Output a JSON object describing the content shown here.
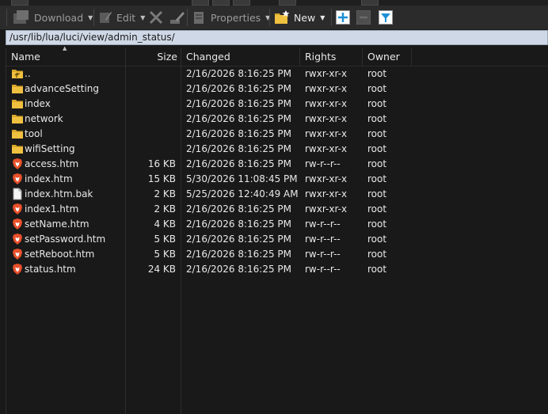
{
  "toolbar": {
    "download_label": "Download",
    "edit_label": "Edit",
    "properties_label": "Properties",
    "new_label": "New"
  },
  "address": {
    "path": "/usr/lib/lua/luci/view/admin_status/"
  },
  "columns": {
    "name": "Name",
    "size": "Size",
    "changed": "Changed",
    "rights": "Rights",
    "owner": "Owner"
  },
  "files": [
    {
      "name": "..",
      "size": "",
      "changed": "2/16/2026 8:16:25 PM",
      "rights": "rwxr-xr-x",
      "owner": "root",
      "icon": "parent-folder-icon"
    },
    {
      "name": "advanceSetting",
      "size": "",
      "changed": "2/16/2026 8:16:25 PM",
      "rights": "rwxr-xr-x",
      "owner": "root",
      "icon": "folder-icon"
    },
    {
      "name": "index",
      "size": "",
      "changed": "2/16/2026 8:16:25 PM",
      "rights": "rwxr-xr-x",
      "owner": "root",
      "icon": "folder-icon"
    },
    {
      "name": "network",
      "size": "",
      "changed": "2/16/2026 8:16:25 PM",
      "rights": "rwxr-xr-x",
      "owner": "root",
      "icon": "folder-icon"
    },
    {
      "name": "tool",
      "size": "",
      "changed": "2/16/2026 8:16:25 PM",
      "rights": "rwxr-xr-x",
      "owner": "root",
      "icon": "folder-icon"
    },
    {
      "name": "wifiSetting",
      "size": "",
      "changed": "2/16/2026 8:16:25 PM",
      "rights": "rwxr-xr-x",
      "owner": "root",
      "icon": "folder-icon"
    },
    {
      "name": "access.htm",
      "size": "16 KB",
      "changed": "2/16/2026 8:16:25 PM",
      "rights": "rw-r--r--",
      "owner": "root",
      "icon": "brave-browser-icon"
    },
    {
      "name": "index.htm",
      "size": "15 KB",
      "changed": "5/30/2026 11:08:45 PM",
      "rights": "rwxr-xr-x",
      "owner": "root",
      "icon": "brave-browser-icon"
    },
    {
      "name": "index.htm.bak",
      "size": "2 KB",
      "changed": "5/25/2026 12:40:49 AM",
      "rights": "rwxr-xr-x",
      "owner": "root",
      "icon": "file-icon"
    },
    {
      "name": "index1.htm",
      "size": "2 KB",
      "changed": "2/16/2026 8:16:25 PM",
      "rights": "rwxr-xr-x",
      "owner": "root",
      "icon": "brave-browser-icon"
    },
    {
      "name": "setName.htm",
      "size": "4 KB",
      "changed": "2/16/2026 8:16:25 PM",
      "rights": "rw-r--r--",
      "owner": "root",
      "icon": "brave-browser-icon"
    },
    {
      "name": "setPassword.htm",
      "size": "5 KB",
      "changed": "2/16/2026 8:16:25 PM",
      "rights": "rw-r--r--",
      "owner": "root",
      "icon": "brave-browser-icon"
    },
    {
      "name": "setReboot.htm",
      "size": "5 KB",
      "changed": "2/16/2026 8:16:25 PM",
      "rights": "rw-r--r--",
      "owner": "root",
      "icon": "brave-browser-icon"
    },
    {
      "name": "status.htm",
      "size": "24 KB",
      "changed": "2/16/2026 8:16:25 PM",
      "rights": "rw-r--r--",
      "owner": "root",
      "icon": "brave-browser-icon"
    }
  ],
  "colors": {
    "folder": "#f0c040",
    "brave": "#e8502a",
    "address_bg": "#cfd8e6",
    "accent_blue": "#1e90d6"
  }
}
